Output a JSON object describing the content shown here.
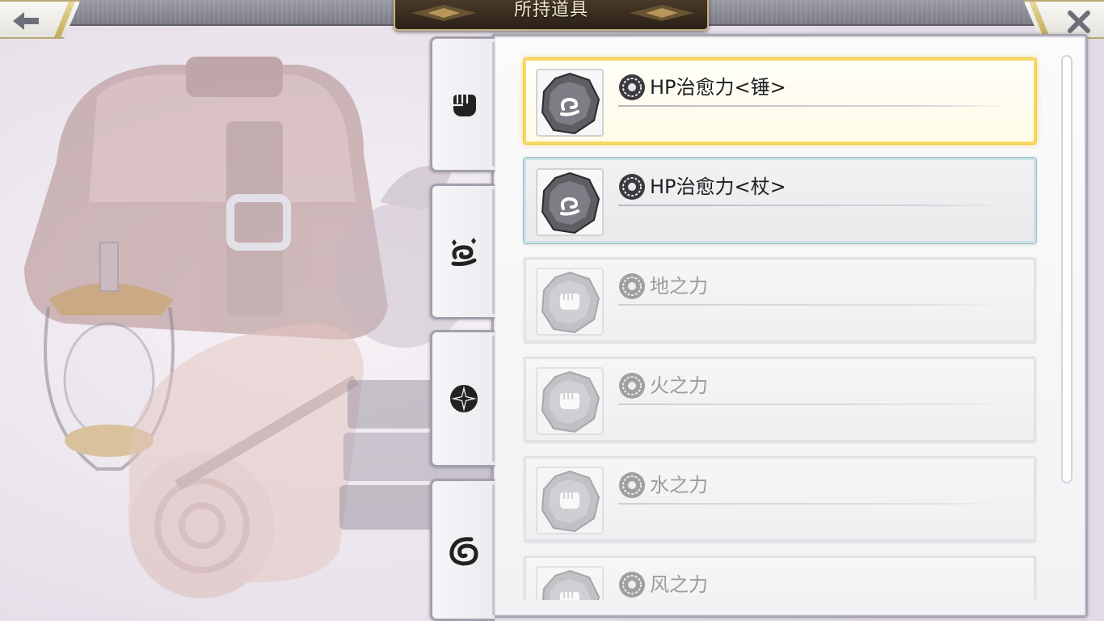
{
  "header": {
    "title": "所持道具",
    "back_icon": "arrow-left-icon",
    "close_icon": "close-icon"
  },
  "tabs": [
    {
      "icon": "fist-icon",
      "active": false
    },
    {
      "icon": "swirl-sparkle-icon",
      "active": true
    },
    {
      "icon": "compass-star-icon",
      "active": false
    },
    {
      "icon": "wave-swirl-icon",
      "active": false
    }
  ],
  "items": [
    {
      "name": "HP治愈力<锤>",
      "icon": "swirl-sparkle-icon",
      "state": "selected"
    },
    {
      "name": "HP治愈力<杖>",
      "icon": "swirl-sparkle-icon",
      "state": "owned"
    },
    {
      "name": "地之力",
      "icon": "fist-icon",
      "state": "dim"
    },
    {
      "name": "火之力",
      "icon": "fist-icon",
      "state": "dim"
    },
    {
      "name": "水之力",
      "icon": "fist-icon",
      "state": "dim"
    },
    {
      "name": "风之力",
      "icon": "fist-icon",
      "state": "dim"
    }
  ],
  "colors": {
    "accent_gold": "#f7da63",
    "title_plate": "#2a2017",
    "panel_border": "#a9a6b3"
  }
}
